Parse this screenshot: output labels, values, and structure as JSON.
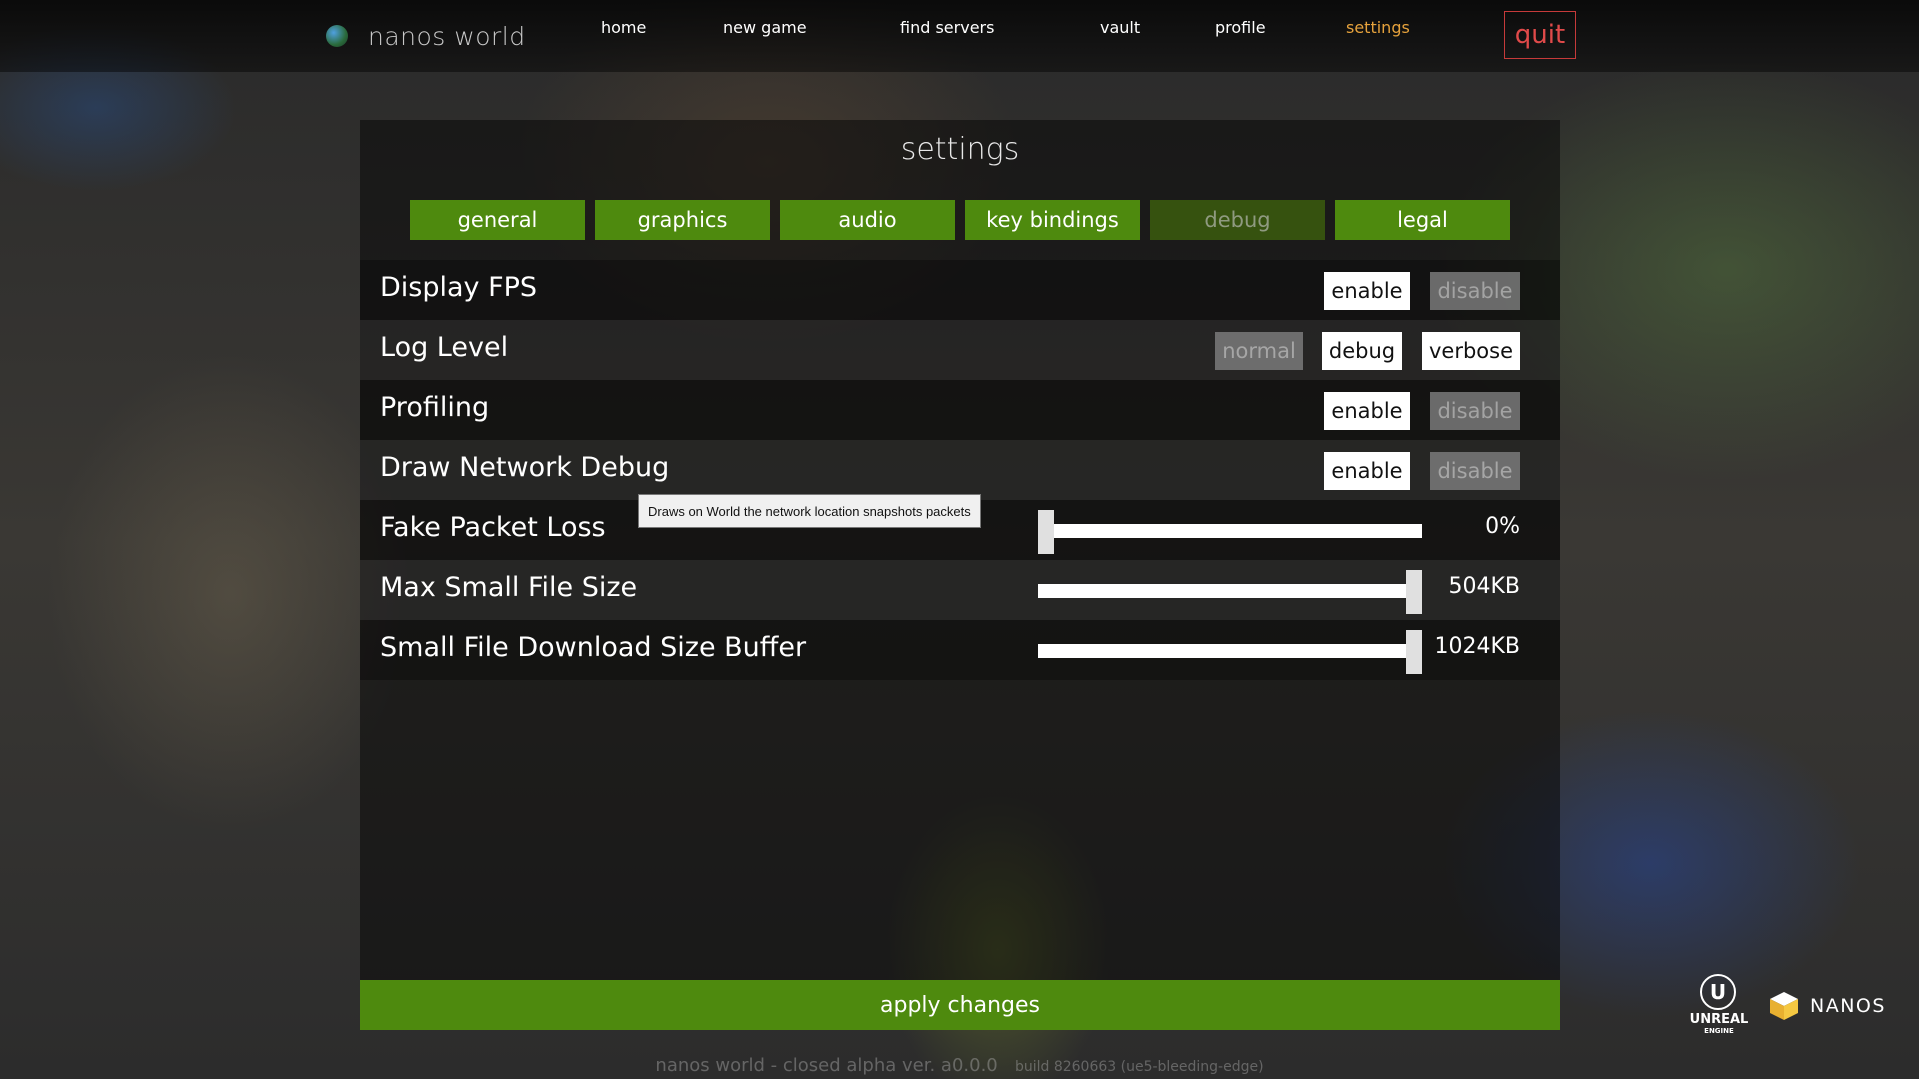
{
  "brand": {
    "name": "nanos world"
  },
  "nav": {
    "items": [
      {
        "label": "home"
      },
      {
        "label": "new game"
      },
      {
        "label": "find servers"
      },
      {
        "label": "vault"
      },
      {
        "label": "profile"
      },
      {
        "label": "settings",
        "active": true
      }
    ],
    "quit_label": "quit"
  },
  "settings": {
    "title": "settings",
    "tabs": [
      {
        "label": "general"
      },
      {
        "label": "graphics"
      },
      {
        "label": "audio"
      },
      {
        "label": "key bindings"
      },
      {
        "label": "debug",
        "active": true
      },
      {
        "label": "legal"
      }
    ],
    "rows": {
      "display_fps": {
        "label": "Display FPS",
        "enable": "enable",
        "disable": "disable",
        "selected": "enable"
      },
      "log_level": {
        "label": "Log Level",
        "normal": "normal",
        "debug": "debug",
        "verbose": "verbose"
      },
      "profiling": {
        "label": "Profiling",
        "enable": "enable",
        "disable": "disable",
        "selected": "enable"
      },
      "draw_network_debug": {
        "label": "Draw Network Debug",
        "enable": "enable",
        "disable": "disable",
        "selected": "enable"
      },
      "fake_packet_loss": {
        "label": "Fake Packet Loss",
        "value_text": "0%",
        "fraction": 0.0
      },
      "max_small_file_size": {
        "label": "Max Small File Size",
        "value_text": "504KB",
        "fraction": 1.0
      },
      "small_file_buffer": {
        "label": "Small File Download Size Buffer",
        "value_text": "1024KB",
        "fraction": 1.0
      }
    },
    "tooltip": "Draws on World the network location snapshots packets",
    "apply_label": "apply changes"
  },
  "footer": {
    "version": "nanos world - closed alpha  ver. a0.0.0",
    "build": "build 8260663  (ue5-bleeding-edge)"
  },
  "logos": {
    "unreal_line1": "UNREAL",
    "unreal_line2": "ENGINE",
    "nanos": "NANOS"
  },
  "colors": {
    "accent_green": "#4e8a0e",
    "active_nav": "#e6a23c",
    "quit_red": "#e04a4a"
  }
}
